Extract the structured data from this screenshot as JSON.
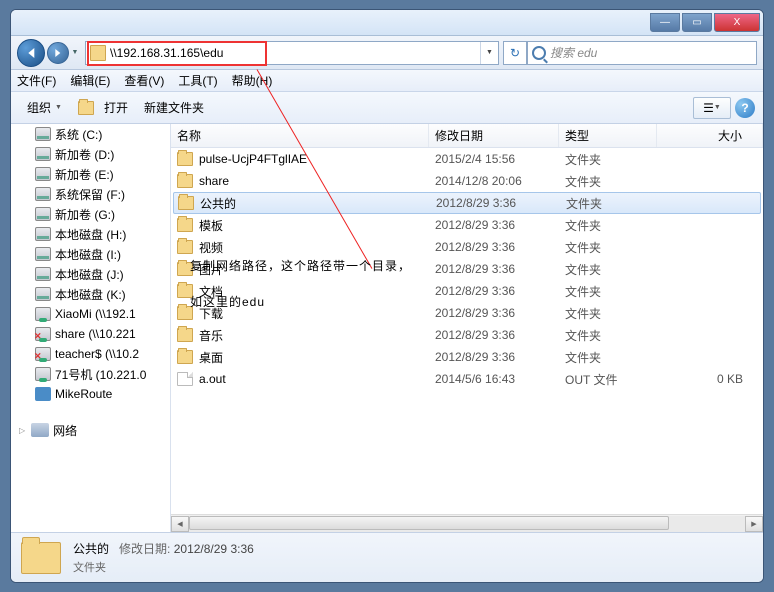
{
  "window": {
    "min": "—",
    "max": "▭",
    "close": "X",
    "address": "\\\\192.168.31.165\\edu",
    "search_placeholder": "搜索 edu"
  },
  "menu": {
    "file": "文件(F)",
    "edit": "编辑(E)",
    "view": "查看(V)",
    "tools": "工具(T)",
    "help": "帮助(H)"
  },
  "toolbar": {
    "organize": "组织",
    "open": "打开",
    "newfolder": "新建文件夹",
    "view": "☰",
    "help": "?"
  },
  "columns": {
    "name": "名称",
    "date": "修改日期",
    "type": "类型",
    "size": "大小"
  },
  "sidebar": {
    "items": [
      {
        "label": "系统 (C:)",
        "icon": "drive"
      },
      {
        "label": "新加卷 (D:)",
        "icon": "drive"
      },
      {
        "label": "新加卷 (E:)",
        "icon": "drive"
      },
      {
        "label": "系统保留 (F:)",
        "icon": "drive"
      },
      {
        "label": "新加卷 (G:)",
        "icon": "drive"
      },
      {
        "label": "本地磁盘 (H:)",
        "icon": "drive"
      },
      {
        "label": "本地磁盘 (I:)",
        "icon": "drive"
      },
      {
        "label": "本地磁盘 (J:)",
        "icon": "drive"
      },
      {
        "label": "本地磁盘 (K:)",
        "icon": "drive"
      },
      {
        "label": "XiaoMi (\\\\192.1",
        "icon": "netshare"
      },
      {
        "label": "share (\\\\10.221",
        "icon": "netsharex"
      },
      {
        "label": "teacher$ (\\\\10.2",
        "icon": "netsharex"
      },
      {
        "label": "71号机 (10.221.0",
        "icon": "netshare"
      },
      {
        "label": "MikeRoute",
        "icon": "router"
      }
    ],
    "network": "网络"
  },
  "files": [
    {
      "name": "pulse-UcjP4FTglIAE",
      "date": "2015/2/4 15:56",
      "type": "文件夹",
      "size": "",
      "icon": "folder"
    },
    {
      "name": "share",
      "date": "2014/12/8 20:06",
      "type": "文件夹",
      "size": "",
      "icon": "folder"
    },
    {
      "name": "公共的",
      "date": "2012/8/29 3:36",
      "type": "文件夹",
      "size": "",
      "icon": "folder",
      "selected": true
    },
    {
      "name": "模板",
      "date": "2012/8/29 3:36",
      "type": "文件夹",
      "size": "",
      "icon": "folder"
    },
    {
      "name": "视频",
      "date": "2012/8/29 3:36",
      "type": "文件夹",
      "size": "",
      "icon": "folder"
    },
    {
      "name": "图片",
      "date": "2012/8/29 3:36",
      "type": "文件夹",
      "size": "",
      "icon": "folder"
    },
    {
      "name": "文档",
      "date": "2012/8/29 3:36",
      "type": "文件夹",
      "size": "",
      "icon": "folder"
    },
    {
      "name": "下载",
      "date": "2012/8/29 3:36",
      "type": "文件夹",
      "size": "",
      "icon": "folder"
    },
    {
      "name": "音乐",
      "date": "2012/8/29 3:36",
      "type": "文件夹",
      "size": "",
      "icon": "folder"
    },
    {
      "name": "桌面",
      "date": "2012/8/29 3:36",
      "type": "文件夹",
      "size": "",
      "icon": "folder"
    },
    {
      "name": "a.out",
      "date": "2014/5/6 16:43",
      "type": "OUT 文件",
      "size": "0 KB",
      "icon": "file"
    }
  ],
  "status": {
    "name": "公共的",
    "date_label": "修改日期:",
    "date": "2012/8/29 3:36",
    "type": "文件夹"
  },
  "annotation": {
    "line1": "复制网络路径，这个路径带一个目录，",
    "line2": "如这里的edu"
  }
}
